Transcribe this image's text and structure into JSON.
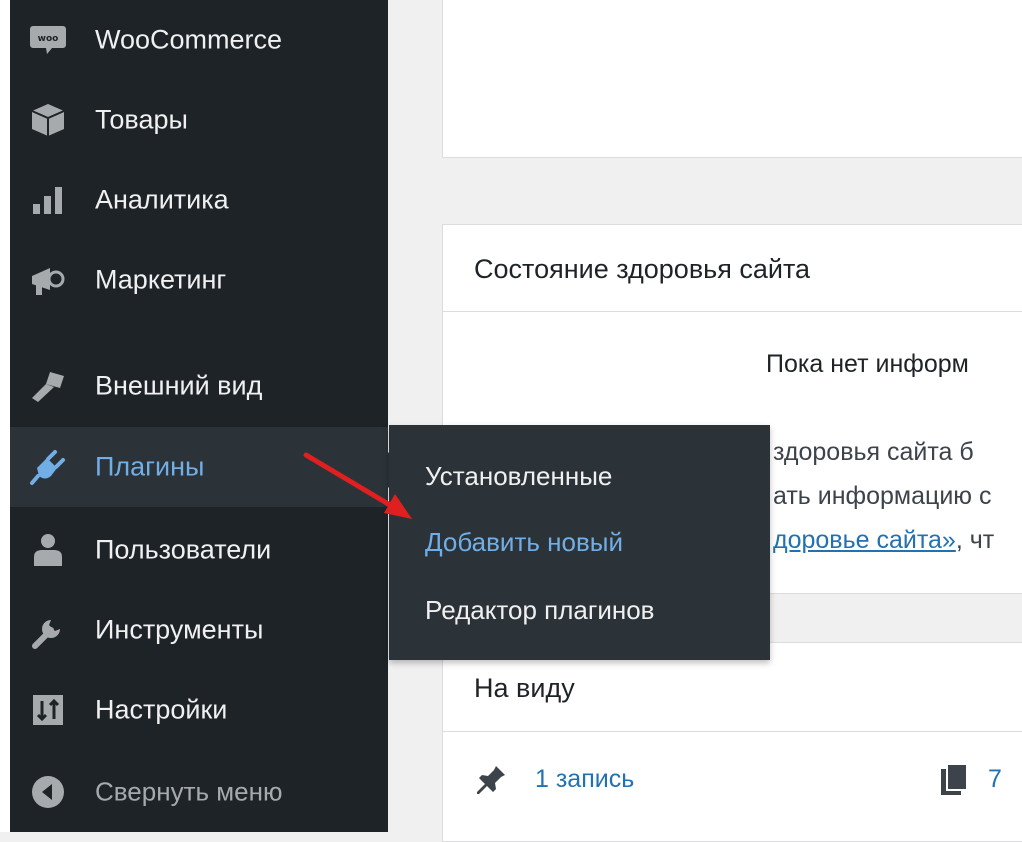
{
  "sidebar": {
    "items": [
      {
        "label": "WooCommerce",
        "icon": "woo-icon"
      },
      {
        "label": "Товары",
        "icon": "box-icon"
      },
      {
        "label": "Аналитика",
        "icon": "bar-chart-icon"
      },
      {
        "label": "Маркетинг",
        "icon": "megaphone-icon"
      },
      {
        "label": "Внешний вид",
        "icon": "paintbrush-icon"
      },
      {
        "label": "Плагины",
        "icon": "plug-icon"
      },
      {
        "label": "Пользователи",
        "icon": "user-icon"
      },
      {
        "label": "Инструменты",
        "icon": "wrench-icon"
      },
      {
        "label": "Настройки",
        "icon": "settings-sliders-icon"
      },
      {
        "label": "Свернуть меню",
        "icon": "collapse-arrow-icon"
      }
    ],
    "active": "Плагины"
  },
  "flyout": {
    "items": [
      "Установленные",
      "Добавить новый",
      "Редактор плагинов"
    ],
    "highlighted": "Добавить новый"
  },
  "site_health": {
    "title": "Состояние здоровья сайта",
    "heading_fragment": "Пока нет информ",
    "line1_fragment": "здоровья сайта б",
    "line2_fragment": "ать информацию с",
    "link_fragment": "доровье сайта»",
    "after_link_fragment": ", чт"
  },
  "at_a_glance": {
    "title": "На виду",
    "posts": "1 запись",
    "pages_count_fragment": "7"
  },
  "colors": {
    "sidebar_bg": "#1d2327",
    "active_bg": "#2c3338",
    "active_text": "#72aee6",
    "link": "#2271b1",
    "annotation_arrow": "#e02020"
  }
}
